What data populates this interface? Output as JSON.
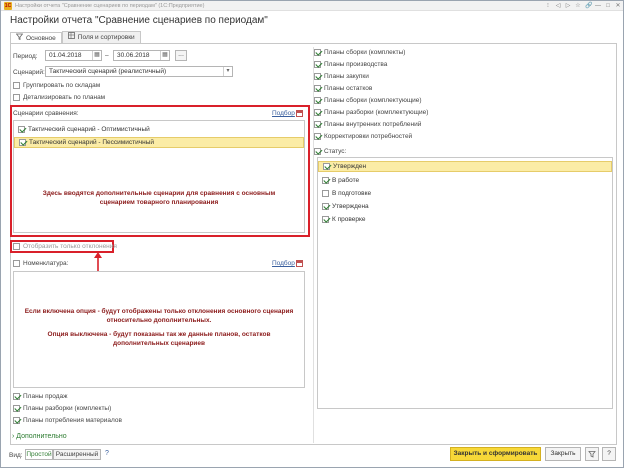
{
  "window": {
    "title": "Настройки отчета \"Сравнение сценариев по периодам\" (1С:Предприятие)",
    "app_icon_text": "1С",
    "controls": [
      "⁝",
      "◁",
      "▷",
      "☆",
      "🔗",
      "—",
      "□",
      "✕"
    ]
  },
  "heading": "Настройки отчета \"Сравнение сценариев по периодам\"",
  "tabs": [
    {
      "label": "Основное",
      "icon": "filter-icon",
      "active": true
    },
    {
      "label": "Поля и сортировки",
      "icon": "table-icon",
      "active": false
    }
  ],
  "period": {
    "label": "Период:",
    "from": "01.04.2018",
    "dash": "–",
    "to": "30.06.2018",
    "more_button": "..."
  },
  "scenario": {
    "label": "Сценарий:",
    "value": "Тактический сценарий (реалистичный)"
  },
  "options": [
    {
      "label": "Группировать по складам",
      "checked": false
    },
    {
      "label": "Детализировать по планам",
      "checked": false
    }
  ],
  "compare_scenarios": {
    "label": "Сценарии сравнения:",
    "link": "Подбор",
    "items": [
      {
        "label": "Тактический сценарий - Оптимистичный",
        "checked": true,
        "selected": false
      },
      {
        "label": "Тактический сценарий - Пессимистичный",
        "checked": true,
        "selected": true
      }
    ],
    "annotation_line1": "Здесь вводятся дополнительные сценарии для сравнения с основным",
    "annotation_line2": "сценарием товарного планирования"
  },
  "deviations_only": {
    "label": "Отобразить только отклонения",
    "checked": false
  },
  "nomenclature": {
    "label": "Номенклатура:",
    "link": "Подбор",
    "annotation1_line1": "Если включена опция -  будут отображены только отклонения основного сценария",
    "annotation1_line2": "относительно дополнительных.",
    "annotation2_line1": "Опция выключена - будут показаны так же данные планов, остатков",
    "annotation2_line2": "дополнительных сценариев"
  },
  "left_plans": [
    {
      "label": "Планы продаж",
      "checked": true
    },
    {
      "label": "Планы разборки (комплекты)",
      "checked": true
    },
    {
      "label": "Планы потребления материалов",
      "checked": true
    }
  ],
  "more_link": "Дополнительно",
  "right_plans": [
    {
      "label": "Планы сборки (комплекты)",
      "checked": true
    },
    {
      "label": "Планы производства",
      "checked": true
    },
    {
      "label": "Планы закупки",
      "checked": true
    },
    {
      "label": "Планы остатков",
      "checked": true
    },
    {
      "label": "Планы сборки (комплектующие)",
      "checked": true
    },
    {
      "label": "Планы разборки (комплектующие)",
      "checked": true
    },
    {
      "label": "Планы внутренних потреблений",
      "checked": true
    },
    {
      "label": "Корректировки потребностей",
      "checked": true
    }
  ],
  "status": {
    "label": "Статус:",
    "checked": true,
    "items": [
      {
        "label": "Утвержден",
        "checked": true,
        "selected": true
      },
      {
        "label": "В работе",
        "checked": true,
        "selected": false
      },
      {
        "label": "В подготовке",
        "checked": false,
        "selected": false
      },
      {
        "label": "Утверждена",
        "checked": true,
        "selected": false
      },
      {
        "label": "К проверке",
        "checked": true,
        "selected": false
      }
    ]
  },
  "bottom": {
    "view_label": "Вид:",
    "view_simple": "Простой",
    "view_extended": "Расширенный",
    "help_mark": "?",
    "close_and_build": "Закрыть и сформировать",
    "close": "Закрыть",
    "settings_icon": "settings-icon",
    "help_button": "?"
  },
  "colors": {
    "highlight_border": "#d9202a",
    "selection": "#fbeca6",
    "primary_button": "#f7d838",
    "check": "#2e7d32",
    "link": "#3a5f9e"
  }
}
